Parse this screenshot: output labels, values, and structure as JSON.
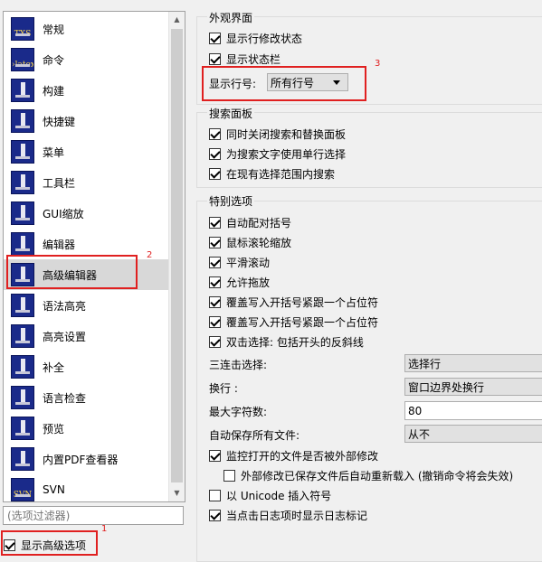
{
  "sidebar": {
    "items": [
      {
        "label": "常规",
        "icon": "txs-icon",
        "glyph": "TXS"
      },
      {
        "label": "命令",
        "icon": "latex-icon",
        "glyph": "›latex"
      },
      {
        "label": "构建",
        "icon": "build-icon",
        "glyph": ""
      },
      {
        "label": "快捷键",
        "icon": "shortcut-icon",
        "glyph": ""
      },
      {
        "label": "菜单",
        "icon": "menu-icon",
        "glyph": ""
      },
      {
        "label": "工具栏",
        "icon": "toolbar-icon",
        "glyph": ""
      },
      {
        "label": "GUI缩放",
        "icon": "gui-scale-icon",
        "glyph": ""
      },
      {
        "label": "编辑器",
        "icon": "editor-icon",
        "glyph": ""
      },
      {
        "label": "高级编辑器",
        "icon": "advanced-editor-icon",
        "glyph": ""
      },
      {
        "label": "语法高亮",
        "icon": "syntax-highlight-icon",
        "glyph": ""
      },
      {
        "label": "高亮设置",
        "icon": "highlight-settings-icon",
        "glyph": ""
      },
      {
        "label": "补全",
        "icon": "completion-icon",
        "glyph": ""
      },
      {
        "label": "语言检查",
        "icon": "language-check-icon",
        "glyph": ""
      },
      {
        "label": "预览",
        "icon": "preview-icon",
        "glyph": ""
      },
      {
        "label": "内置PDF查看器",
        "icon": "pdf-viewer-icon",
        "glyph": ""
      },
      {
        "label": "SVN",
        "icon": "svn-icon",
        "glyph": "SVN"
      }
    ],
    "selected_index": 8,
    "filter_placeholder": "(选项过滤器)",
    "show_advanced_label": "显示高级选项",
    "show_advanced_checked": true
  },
  "appearance": {
    "title": "外观界面",
    "show_line_state": "显示行修改状态",
    "show_status_bar": "显示状态栏",
    "line_numbers_label": "显示行号:",
    "line_numbers_value": "所有行号"
  },
  "search": {
    "title": "搜索面板",
    "close_together": "同时关闭搜索和替换面板",
    "single_line": "为搜索文字使用单行选择",
    "in_selection": "在现有选择范围内搜索"
  },
  "special": {
    "title": "特别选项",
    "auto_brackets": "自动配对括号",
    "wheel_zoom": "鼠标滚轮缩放",
    "smooth_scroll": "平滑滚动",
    "drag_drop": "允许拖放",
    "overwrite_1": "覆盖写入开括号紧跟一个占位符",
    "overwrite_2": "覆盖写入开括号紧跟一个占位符",
    "double_click": "双击选择: 包括开头的反斜线",
    "triple_click_label": "三连击选择:",
    "triple_click_value": "选择行",
    "wrap_label": "换行 :",
    "wrap_value": "窗口边界处换行",
    "max_chars_label": "最大字符数:",
    "max_chars_value": "80",
    "autosave_label": "自动保存所有文件:",
    "autosave_value": "从不",
    "monitor_external": "监控打开的文件是否被外部修改",
    "auto_reload": "外部修改已保存文件后自动重新载入 (撤销命令将会失效)",
    "unicode_insert": "以 Unicode 插入符号",
    "log_on_click": "当点击日志项时显示日志标记"
  },
  "annotations": [
    "1",
    "2",
    "3"
  ],
  "colors": {
    "annotation": "#e02020",
    "icon_bg": "#1a2a8a",
    "selected_bg": "#d8d8d8"
  }
}
